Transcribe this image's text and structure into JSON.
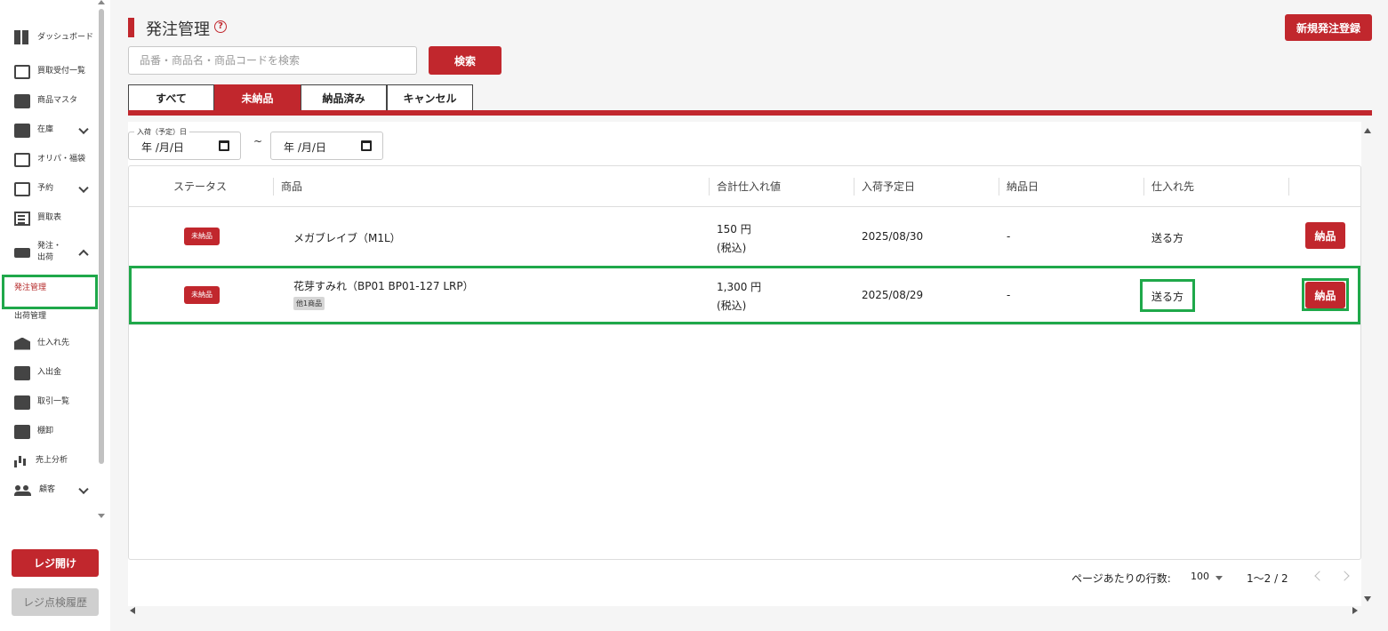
{
  "sidebar": {
    "items": [
      {
        "label": "ダッシュボード",
        "icon": "dashboard-icon"
      },
      {
        "label": "買取受付一覧",
        "icon": "receipt-icon"
      },
      {
        "label": "商品マスタ",
        "icon": "store-icon"
      },
      {
        "label": "在庫",
        "icon": "archive-icon"
      },
      {
        "label": "オリパ・福袋",
        "icon": "gift-icon"
      },
      {
        "label": "予約",
        "icon": "calendar-icon"
      },
      {
        "label": "買取表",
        "icon": "list-icon"
      },
      {
        "label": "発注・出荷",
        "icon": "truck-icon"
      },
      {
        "label": "発注管理"
      },
      {
        "label": "出荷管理"
      },
      {
        "label": "仕入れ先",
        "icon": "bank-icon"
      },
      {
        "label": "入出金",
        "icon": "cash-register-icon"
      },
      {
        "label": "取引一覧",
        "icon": "folder-arrow-icon"
      },
      {
        "label": "棚卸",
        "icon": "clipboard-check-icon"
      },
      {
        "label": "売上分析",
        "icon": "bar-chart-icon"
      },
      {
        "label": "顧客",
        "icon": "people-icon"
      }
    ],
    "register_open_label": "レジ開け",
    "register_history_label": "レジ点検履歴"
  },
  "header": {
    "title": "発注管理",
    "help_glyph": "?",
    "new_order_label": "新規発注登録"
  },
  "search": {
    "placeholder": "品番・商品名・商品コードを検索",
    "button_label": "検索"
  },
  "tabs": [
    {
      "label": "すべて",
      "active": false
    },
    {
      "label": "未納品",
      "active": true
    },
    {
      "label": "納品済み",
      "active": false
    },
    {
      "label": "キャンセル",
      "active": false
    }
  ],
  "filters": {
    "date_legend": "入荷（予定）日",
    "date_from": "年 /月/日",
    "date_to": "年 /月/日",
    "separator": "~"
  },
  "table": {
    "columns": [
      "ステータス",
      "商品",
      "合計仕入れ値",
      "入荷予定日",
      "納品日",
      "仕入れ先"
    ],
    "rows": [
      {
        "status": "未納品",
        "product": "メガブレイブ（M1L）",
        "extra": "",
        "price": "150 円",
        "tax": "(税込)",
        "arrival": "2025/08/30",
        "delivered": "-",
        "supplier": "送る方",
        "action": "納品"
      },
      {
        "status": "未納品",
        "product": "花芽すみれ（BP01 BP01-127 LRP）",
        "extra": "他1商品",
        "price": "1,300 円",
        "tax": "(税込)",
        "arrival": "2025/08/29",
        "delivered": "-",
        "supplier": "送る方",
        "action": "納品"
      }
    ]
  },
  "pagination": {
    "rows_per_page_label": "ページあたりの行数:",
    "rows_per_page": "100",
    "range": "1〜2 / 2"
  },
  "colors": {
    "accent": "#c1272d",
    "highlight": "#1fa84a"
  }
}
